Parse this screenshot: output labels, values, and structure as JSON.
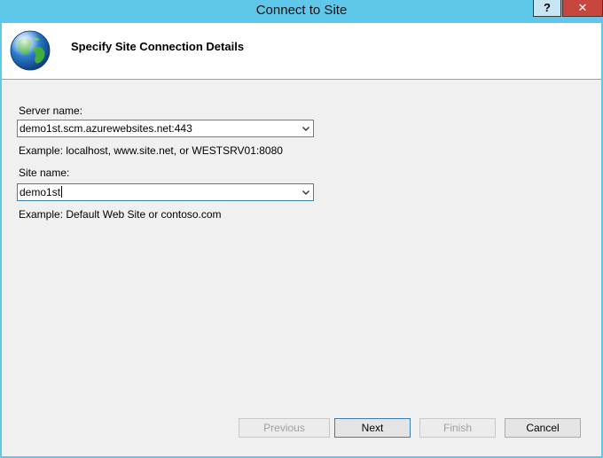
{
  "window": {
    "title": "Connect to Site",
    "help_label": "?",
    "close_label": "✕"
  },
  "header": {
    "title": "Specify Site Connection Details",
    "icon": "globe-icon"
  },
  "server": {
    "label": "Server name:",
    "value": "demo1st.scm.azurewebsites.net:443",
    "example": "Example: localhost, www.site.net, or WESTSRV01:8080"
  },
  "site": {
    "label": "Site name:",
    "value": "demo1st",
    "example": "Example: Default Web Site or contoso.com"
  },
  "buttons": {
    "previous": "Previous",
    "next": "Next",
    "finish": "Finish",
    "cancel": "Cancel"
  },
  "colors": {
    "window_frame": "#5fc7ea",
    "close_button": "#c7473f",
    "focus_border": "#3c7fb1"
  }
}
